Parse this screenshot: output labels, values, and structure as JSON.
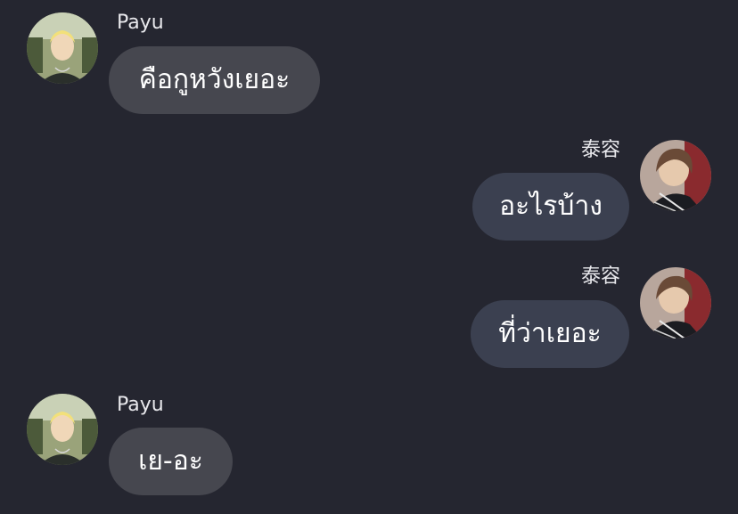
{
  "colors": {
    "background": "#252630",
    "incoming_bubble": "#46474f",
    "outgoing_bubble": "#3b4050",
    "text": "#ffffff"
  },
  "messages": [
    {
      "sender": "Payu",
      "direction": "incoming",
      "text": "คือกูหวังเยอะ",
      "avatar": "payu-avatar"
    },
    {
      "sender": "泰容",
      "direction": "outgoing",
      "text": "อะไรบ้าง",
      "avatar": "taeyong-avatar"
    },
    {
      "sender": "泰容",
      "direction": "outgoing",
      "text": "ที่ว่าเยอะ",
      "avatar": "taeyong-avatar"
    },
    {
      "sender": "Payu",
      "direction": "incoming",
      "text": "เย-อะ",
      "avatar": "payu-avatar"
    }
  ]
}
